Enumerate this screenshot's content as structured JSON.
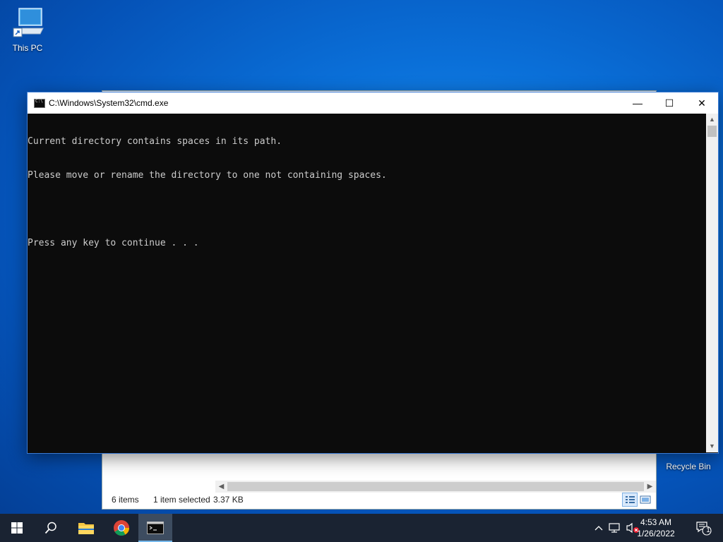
{
  "desktop": {
    "icons": [
      {
        "label": "This PC"
      },
      {
        "label": "Recycle Bin"
      }
    ]
  },
  "explorer": {
    "status": {
      "items_count": "6 items",
      "selection": "1 item selected",
      "size": "3.37 KB"
    }
  },
  "cmd": {
    "title": "C:\\Windows\\System32\\cmd.exe",
    "lines": [
      "Current directory contains spaces in its path.",
      "Please move or rename the directory to one not containing spaces.",
      "",
      "Press any key to continue . . ."
    ],
    "controls": {
      "minimize": "—",
      "maximize": "☐",
      "close": "✕"
    }
  },
  "taskbar": {
    "apps": [
      {
        "name": "start-button-icon"
      },
      {
        "name": "search-icon"
      },
      {
        "name": "file-explorer-icon"
      },
      {
        "name": "chrome-icon"
      },
      {
        "name": "cmd-icon",
        "active": true
      }
    ],
    "clock": {
      "time": "4:53 AM",
      "date": "1/26/2022"
    },
    "notifications_count": "1"
  },
  "colors": {
    "accent": "#76b9ed",
    "console_bg": "#0c0c0c",
    "console_fg": "#cccccc",
    "taskbar_bg": "#1a2332"
  }
}
